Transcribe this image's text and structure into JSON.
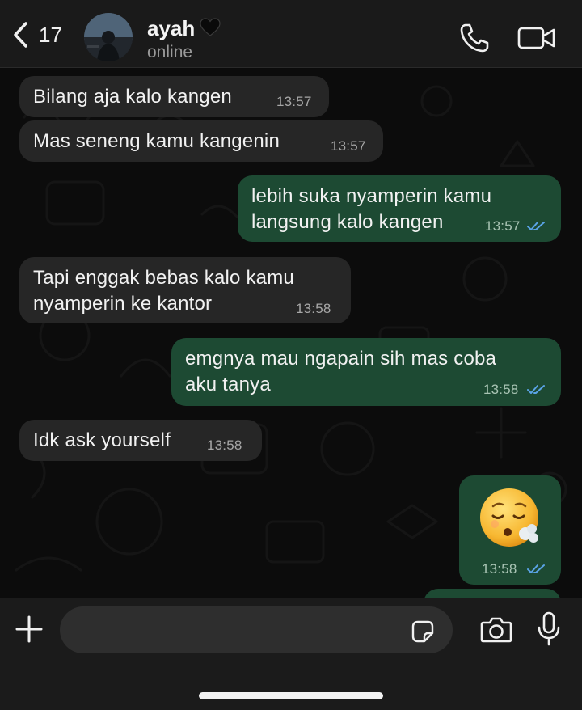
{
  "header": {
    "back_count": "17",
    "contact_name": "ayah",
    "status": "online",
    "heart_icon": "black-heart-icon",
    "call_icon": "phone-icon",
    "video_icon": "video-camera-icon"
  },
  "messages": [
    {
      "direction": "incoming",
      "text": "Bilang aja kalo kangen",
      "time": "13:57"
    },
    {
      "direction": "incoming",
      "text": "Mas seneng kamu kangenin",
      "time": "13:57"
    },
    {
      "direction": "outgoing",
      "text": "lebih suka nyamperin kamu\nlangsung kalo kangen",
      "time": "13:57",
      "read": true
    },
    {
      "direction": "incoming",
      "text": "Tapi enggak bebas kalo kamu\nnyamperin ke kantor",
      "time": "13:58"
    },
    {
      "direction": "outgoing",
      "text": "emgnya mau ngapain sih mas coba\naku tanya",
      "time": "13:58",
      "read": true
    },
    {
      "direction": "incoming",
      "text": "Idk ask yourself",
      "time": "13:58"
    },
    {
      "direction": "outgoing",
      "text": "",
      "emoji": "face-exhaling-emoji",
      "time": "13:58",
      "read": true
    }
  ],
  "composer": {
    "placeholder": "",
    "plus_icon": "plus-icon",
    "sticker_icon": "sticker-icon",
    "camera_icon": "camera-icon",
    "mic_icon": "microphone-icon"
  },
  "colors": {
    "incoming_bubble": "#262626",
    "outgoing_bubble": "#1d4a33",
    "read_ticks": "#5aa3e6",
    "background": "#0c0c0c"
  }
}
